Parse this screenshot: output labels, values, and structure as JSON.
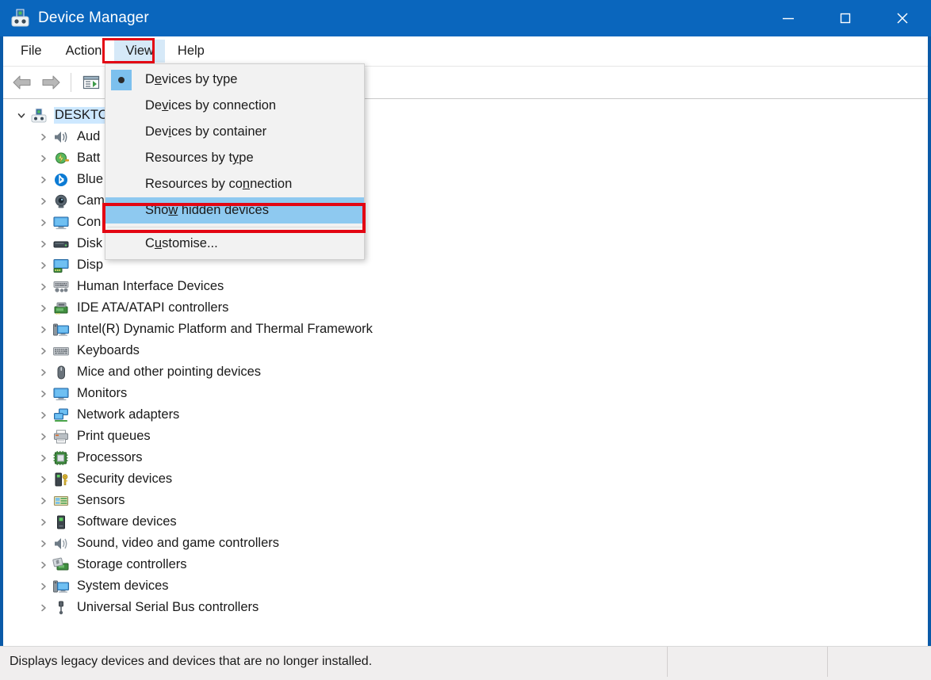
{
  "window": {
    "title": "Device Manager",
    "app_icon": "device-manager-icon",
    "minimize_label": "Minimise",
    "maximize_label": "Maximise",
    "close_label": "Close"
  },
  "menubar": {
    "items": [
      {
        "label": "File",
        "active": false
      },
      {
        "label": "Action",
        "active": false
      },
      {
        "label": "View",
        "active": true
      },
      {
        "label": "Help",
        "active": false
      }
    ]
  },
  "toolbar": {
    "buttons": [
      {
        "name": "back-button",
        "icon": "back-arrow-icon"
      },
      {
        "name": "forward-button",
        "icon": "forward-arrow-icon"
      },
      {
        "name": "show-hide-console-tree-button",
        "icon": "console-tree-icon"
      }
    ]
  },
  "view_menu": {
    "items": [
      {
        "label": "Devices by type",
        "accel": "e",
        "radio": true,
        "checked": true,
        "highlight": false
      },
      {
        "label": "Devices by connection",
        "accel": "v",
        "radio": false,
        "checked": false,
        "highlight": false
      },
      {
        "label": "Devices by container",
        "accel": "i",
        "radio": false,
        "checked": false,
        "highlight": false
      },
      {
        "label": "Resources by type",
        "accel": "y",
        "radio": false,
        "checked": false,
        "highlight": false
      },
      {
        "label": "Resources by connection",
        "accel": "n",
        "radio": false,
        "checked": false,
        "highlight": false
      },
      {
        "label": "Show hidden devices",
        "accel": "w",
        "radio": false,
        "checked": false,
        "highlight": true
      },
      {
        "label": "Customise...",
        "accel": "u",
        "radio": false,
        "checked": false,
        "highlight": false
      }
    ],
    "separator_before_index": 6
  },
  "tree": {
    "root": {
      "label": "DESKTO",
      "icon": "computer-icon",
      "expanded": true,
      "selected": true
    },
    "nodes": [
      {
        "label": "Aud",
        "icon": "audio-icon"
      },
      {
        "label": "Batt",
        "icon": "battery-icon"
      },
      {
        "label": "Blue",
        "icon": "bluetooth-icon"
      },
      {
        "label": "Cam",
        "icon": "camera-icon"
      },
      {
        "label": "Con",
        "icon": "monitor-icon"
      },
      {
        "label": "Disk",
        "icon": "disk-drive-icon"
      },
      {
        "label": "Disp",
        "icon": "display-adapter-icon"
      },
      {
        "label": "Human Interface Devices",
        "icon": "hid-icon"
      },
      {
        "label": "IDE ATA/ATAPI controllers",
        "icon": "ide-controller-icon"
      },
      {
        "label": "Intel(R) Dynamic Platform and Thermal Framework",
        "icon": "system-device-icon"
      },
      {
        "label": "Keyboards",
        "icon": "keyboard-icon"
      },
      {
        "label": "Mice and other pointing devices",
        "icon": "mouse-icon"
      },
      {
        "label": "Monitors",
        "icon": "monitor-icon"
      },
      {
        "label": "Network adapters",
        "icon": "network-adapter-icon"
      },
      {
        "label": "Print queues",
        "icon": "printer-icon"
      },
      {
        "label": "Processors",
        "icon": "processor-icon"
      },
      {
        "label": "Security devices",
        "icon": "security-device-icon"
      },
      {
        "label": "Sensors",
        "icon": "sensor-icon"
      },
      {
        "label": "Software devices",
        "icon": "software-device-icon"
      },
      {
        "label": "Sound, video and game controllers",
        "icon": "sound-icon"
      },
      {
        "label": "Storage controllers",
        "icon": "storage-controller-icon"
      },
      {
        "label": "System devices",
        "icon": "system-device-icon"
      },
      {
        "label": "Universal Serial Bus controllers",
        "icon": "usb-icon"
      }
    ]
  },
  "statusbar": {
    "message": "Displays legacy devices and devices that are no longer installed.",
    "pane2": "",
    "pane3": ""
  },
  "colors": {
    "titlebar": "#0a66bd",
    "window_border": "#0a5aa8",
    "menu_background": "#f2f2f2",
    "menu_highlight": "#8ec9f0",
    "menu_active": "#d6e9f8",
    "annotation_red": "#e30613",
    "tree_selection": "#cde8ff",
    "statusbar": "#f0eeee"
  }
}
